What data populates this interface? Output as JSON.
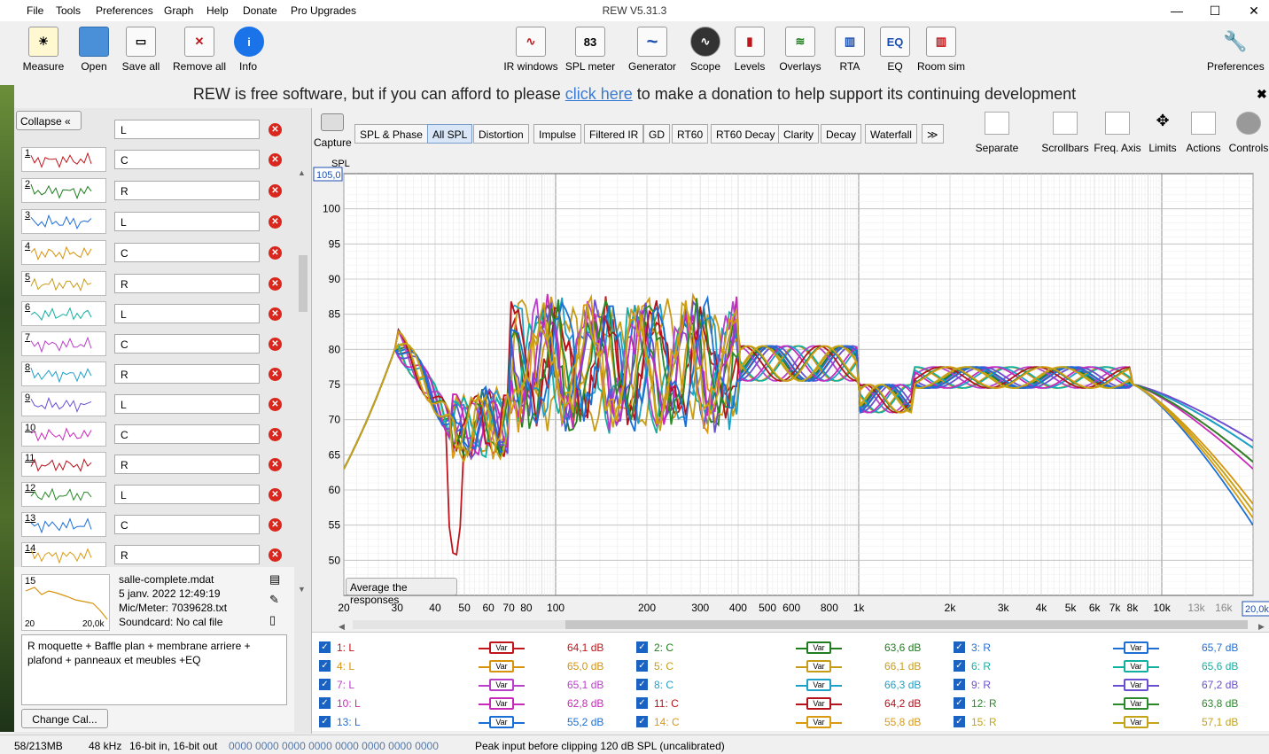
{
  "menu": [
    "File",
    "Tools",
    "Preferences",
    "Graph",
    "Help",
    "Donate",
    "Pro Upgrades"
  ],
  "window_title": "REW V5.31.3",
  "window_buttons": [
    "—",
    "☐",
    "✕"
  ],
  "toolbar_left": [
    {
      "label": "Measure",
      "icon": "measure-icon"
    },
    {
      "label": "Open",
      "icon": "folder-icon"
    },
    {
      "label": "Save all",
      "icon": "save-icon"
    },
    {
      "label": "Remove all",
      "icon": "remove-icon"
    },
    {
      "label": "Info",
      "icon": "info-icon"
    }
  ],
  "toolbar_mid": [
    {
      "label": "IR windows",
      "glyph": "∿"
    },
    {
      "label": "SPL meter",
      "glyph": "83"
    },
    {
      "label": "Generator",
      "glyph": "~"
    },
    {
      "label": "Scope",
      "glyph": "∿"
    },
    {
      "label": "Levels",
      "glyph": "▮"
    },
    {
      "label": "Overlays",
      "glyph": "≋"
    },
    {
      "label": "RTA",
      "glyph": "▥"
    },
    {
      "label": "EQ",
      "glyph": "EQ"
    },
    {
      "label": "Room sim",
      "glyph": "▥"
    }
  ],
  "toolbar_right": {
    "label": "Preferences",
    "icon": "wrench-icon"
  },
  "donate": {
    "pre": "REW is free software, but if you can afford to please ",
    "link": "click here",
    "post": " to make a donation to help support its continuing development"
  },
  "panel": {
    "collapse": "Collapse  «"
  },
  "measurements": [
    {
      "n": "1",
      "name": "L"
    },
    {
      "n": "2",
      "name": "C"
    },
    {
      "n": "3",
      "name": "R"
    },
    {
      "n": "4",
      "name": "L"
    },
    {
      "n": "5",
      "name": "C"
    },
    {
      "n": "6",
      "name": "R"
    },
    {
      "n": "7",
      "name": "L"
    },
    {
      "n": "8",
      "name": "C"
    },
    {
      "n": "9",
      "name": "R"
    },
    {
      "n": "10",
      "name": "L"
    },
    {
      "n": "11",
      "name": "C"
    },
    {
      "n": "12",
      "name": "R"
    },
    {
      "n": "13",
      "name": "L"
    },
    {
      "n": "14",
      "name": "C"
    },
    {
      "n": "15",
      "name": "R"
    }
  ],
  "info": {
    "num": "15",
    "file": "salle-complete.mdat",
    "date": "5 janv. 2022 12:49:19",
    "mic": "Mic/Meter: 7039628.txt",
    "soundcard": "Soundcard: No cal file",
    "thumb_left": "20",
    "thumb_right": "20,0k",
    "notes": "R moquette + Baffle plan + membrane arriere + plafond + panneaux et meubles +EQ",
    "change_cal": "Change Cal..."
  },
  "graph_tabs": [
    "SPL & Phase",
    "All SPL",
    "Distortion",
    "Impulse",
    "Filtered IR",
    "GD",
    "RT60",
    "RT60 Decay",
    "Clarity",
    "Decay",
    "Waterfall",
    "≫"
  ],
  "capture": "Capture",
  "graph_tools": [
    "Separate",
    "Scrollbars",
    "Freq. Axis",
    "Limits",
    "Actions",
    "Controls"
  ],
  "axis": {
    "ylabel": "SPL",
    "ytop": "105,0",
    "yticks": [
      "100",
      "95",
      "90",
      "85",
      "80",
      "75",
      "70",
      "65",
      "60",
      "55",
      "50"
    ],
    "xticks": [
      "20",
      "30",
      "40",
      "50",
      "60",
      "70",
      "80",
      "100",
      "200",
      "300",
      "400",
      "500",
      "600",
      "800",
      "1k",
      "2k",
      "3k",
      "4k",
      "5k",
      "6k",
      "7k",
      "8k",
      "10k",
      "13k",
      "16k"
    ],
    "xend": "20,0k"
  },
  "avg_button": "Average the responses",
  "legend": [
    {
      "name": "1: L",
      "db": "64,1 dB",
      "color": "#c0161b"
    },
    {
      "name": "2: C",
      "db": "63,6 dB",
      "color": "#1f7d1f"
    },
    {
      "name": "3: R",
      "db": "65,7 dB",
      "color": "#1f6ed4"
    },
    {
      "name": "4: L",
      "db": "65,0 dB",
      "color": "#d6930d"
    },
    {
      "name": "5: C",
      "db": "66,1 dB",
      "color": "#c79c1a"
    },
    {
      "name": "6: R",
      "db": "65,6 dB",
      "color": "#12b0a0"
    },
    {
      "name": "7: L",
      "db": "65,1 dB",
      "color": "#b93fc9"
    },
    {
      "name": "8: C",
      "db": "66,3 dB",
      "color": "#1fa0c8"
    },
    {
      "name": "9: R",
      "db": "67,2 dB",
      "color": "#6a4fd0"
    },
    {
      "name": "10: L",
      "db": "62,8 dB",
      "color": "#c829b9"
    },
    {
      "name": "11: C",
      "db": "64,2 dB",
      "color": "#b5121b"
    },
    {
      "name": "12: R",
      "db": "63,8 dB",
      "color": "#2a8a2a"
    },
    {
      "name": "13: L",
      "db": "55,2 dB",
      "color": "#1a6fd6"
    },
    {
      "name": "14: C",
      "db": "55,8 dB",
      "color": "#d99a10"
    },
    {
      "name": "15: R",
      "db": "57,1 dB",
      "color": "#c4a315"
    }
  ],
  "var_label": "Var",
  "status": {
    "mem": "58/213MB",
    "rate": "48 kHz",
    "bits": "16-bit in, 16-bit out",
    "counters": "0000 0000  0000 0000  0000 0000  0000 0000",
    "peak": "Peak input before clipping 120 dB SPL (uncalibrated)"
  }
}
